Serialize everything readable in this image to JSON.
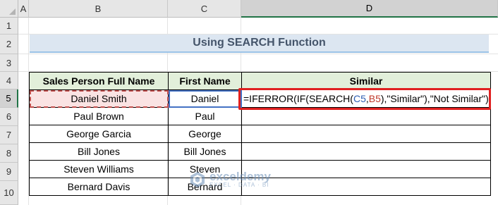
{
  "columns": [
    "A",
    "B",
    "C",
    "D"
  ],
  "rows": [
    "1",
    "2",
    "3",
    "4",
    "5",
    "6",
    "7",
    "8",
    "9",
    "10"
  ],
  "title": "Using SEARCH Function",
  "table": {
    "headers": [
      "Sales Person Full Name",
      "First Name",
      "Similar"
    ],
    "rows": [
      {
        "full": "Daniel Smith",
        "first": "Daniel"
      },
      {
        "full": "Paul Brown",
        "first": "Paul"
      },
      {
        "full": "George Garcia",
        "first": "George"
      },
      {
        "full": "Bill Jones",
        "first": "Bill Jones"
      },
      {
        "full": "Steven Williams",
        "first": "Steven"
      },
      {
        "full": "Bernard Davis",
        "first": "Bernard"
      }
    ]
  },
  "formula": {
    "part1": "=IFERROR(IF(SEARCH(",
    "ref_c": "C5",
    "comma": ",",
    "ref_b": "B5",
    "part2": "),\"Similar\"),\"Not Similar\")"
  },
  "watermark": {
    "main": "exceldemy",
    "sub": "EXCEL · DATA · BI"
  },
  "colors": {
    "selected_col_indicator": "#217346",
    "highlight_box": "#e02020"
  }
}
